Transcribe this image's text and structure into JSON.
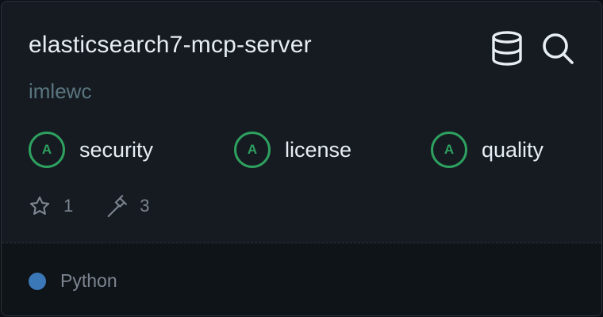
{
  "repo": {
    "name": "elasticsearch7-mcp-server",
    "owner": "imlewc"
  },
  "actions": {
    "database_icon": "database-icon",
    "search_icon": "search-icon"
  },
  "scores": [
    {
      "grade": "A",
      "label": "security"
    },
    {
      "grade": "A",
      "label": "license"
    },
    {
      "grade": "A",
      "label": "quality"
    }
  ],
  "stats": {
    "stars": "1",
    "tools": "3"
  },
  "language": {
    "name": "Python",
    "color": "#3b78b8"
  },
  "colors": {
    "grade_green": "#2ea05f",
    "background": "#151b21"
  }
}
